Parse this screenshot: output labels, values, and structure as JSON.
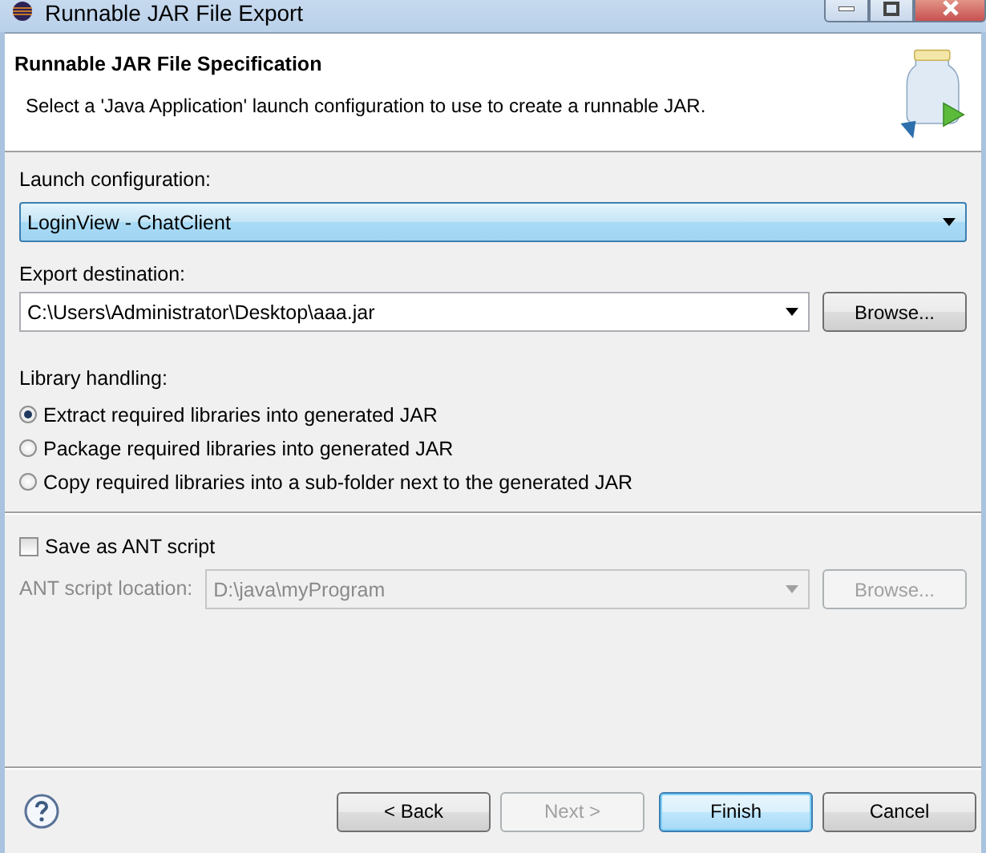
{
  "window": {
    "title": "Runnable JAR File Export"
  },
  "header": {
    "title": "Runnable JAR File Specification",
    "description": "Select a 'Java Application' launch configuration to use to create a runnable JAR."
  },
  "launch_configuration": {
    "label": "Launch configuration:",
    "value": "LoginView - ChatClient",
    "focused": true
  },
  "export_destination": {
    "label": "Export destination:",
    "value": "C:\\Users\\Administrator\\Desktop\\aaa.jar",
    "button": {
      "label": "Browse...",
      "disabled": false
    }
  },
  "library_handling": {
    "label": "Library handling:",
    "options": [
      {
        "label": "Extract required libraries into generated JAR",
        "selected": true
      },
      {
        "label": "Package required libraries into generated JAR",
        "selected": false
      },
      {
        "label": "Copy required libraries into a sub-folder next to the generated JAR",
        "selected": false
      }
    ]
  },
  "ant_script": {
    "checkbox": {
      "label": "Save as ANT script",
      "checked": false
    },
    "location": {
      "label": "ANT script location:",
      "value": "D:\\java\\myProgram",
      "disabled": true
    },
    "button": {
      "label": "Browse...",
      "disabled": true
    }
  },
  "buttons": [
    {
      "label": "< Back",
      "disabled": false,
      "default": false
    },
    {
      "label": "Next >",
      "disabled": true,
      "default": false
    },
    {
      "label": "Finish",
      "disabled": false,
      "default": true
    },
    {
      "label": "Cancel",
      "disabled": false,
      "default": false
    }
  ]
}
